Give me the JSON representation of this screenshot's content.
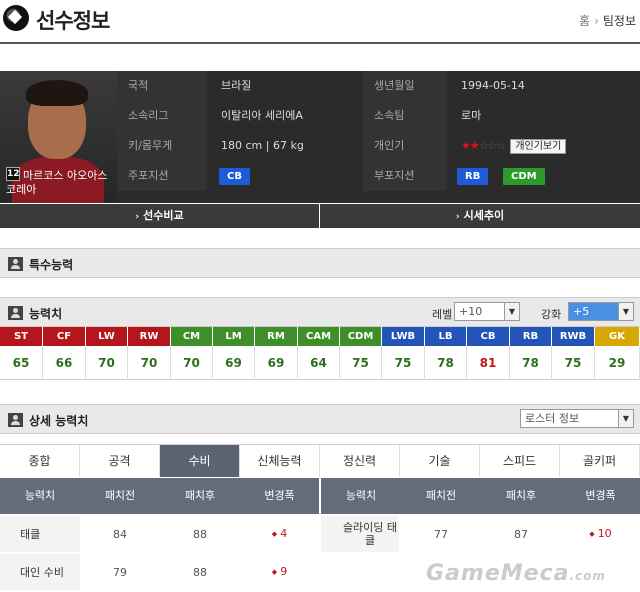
{
  "header": {
    "title": "선수정보",
    "crumbs": [
      "홈",
      "팀정보"
    ]
  },
  "player": {
    "number": "12",
    "name": "마르코스 아오아스 코레아",
    "fields": {
      "nation_label": "국적",
      "nation": "브라질",
      "birth_label": "생년월일",
      "birth": "1994-05-14",
      "league_label": "소속리그",
      "league": "이탈리아 세리에A",
      "team_label": "소속팀",
      "team": "로마",
      "body_label": "키/몸무게",
      "body": "180 cm  |  67 kg",
      "pop_label": "개인기",
      "pop_stars_on": "★★",
      "pop_stars_off": "☆☆☆",
      "open_btn": "개인기보기",
      "main_pos_label": "주포지션",
      "main_pos": "CB",
      "sub_pos_label": "부포지션",
      "sub_pos": [
        "RB",
        "CDM"
      ]
    },
    "colors": {
      "pos_blue": "#1e5bd6",
      "pos_green": "#2e9a2a"
    }
  },
  "actions": {
    "compare": "선수비교",
    "trend": "시세추이"
  },
  "special": {
    "title": "특수능력"
  },
  "ability": {
    "title": "능력치",
    "level_label": "레벨",
    "level_value": "+10",
    "enhance_label": "강화",
    "enhance_value": "+5",
    "positions": [
      "ST",
      "CF",
      "LW",
      "RW",
      "CM",
      "LM",
      "RM",
      "CAM",
      "CDM",
      "LWB",
      "LB",
      "CB",
      "RB",
      "RWB",
      "GK"
    ],
    "values": [
      "65",
      "66",
      "70",
      "70",
      "70",
      "69",
      "69",
      "64",
      "75",
      "75",
      "78",
      "81",
      "78",
      "75",
      "29"
    ]
  },
  "detail": {
    "title": "상세 능력치",
    "roster_select": "로스터 정보",
    "tabs": [
      "종합",
      "공격",
      "수비",
      "신체능력",
      "정신력",
      "기술",
      "스피드",
      "골키퍼"
    ],
    "active_tab": "수비",
    "columns": [
      "능력치",
      "패치전",
      "패치후",
      "변경폭"
    ],
    "left_rows": [
      {
        "name": "태클",
        "before": "84",
        "after": "88",
        "diff": "4"
      },
      {
        "name": "대인 수비",
        "before": "79",
        "after": "88",
        "diff": "9"
      }
    ],
    "right_rows": [
      {
        "name": "슬라이딩 태클",
        "before": "77",
        "after": "87",
        "diff": "10"
      }
    ]
  },
  "watermark": {
    "text": "GameMeca",
    "suffix": ".com"
  }
}
